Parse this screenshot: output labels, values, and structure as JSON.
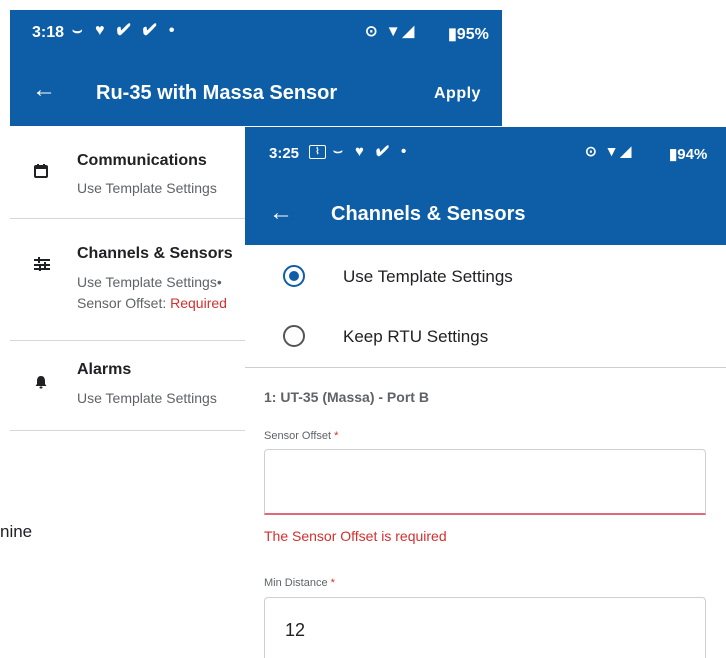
{
  "screen_a": {
    "status_bar": {
      "time": "3:18",
      "left_icons": "⌣ ♥ ✔ ✔ •",
      "right_icons": "⊙ ▼◢",
      "battery": "▮95%"
    },
    "app_bar": {
      "title": "Ru-35 with Massa Sensor",
      "action": "Apply"
    },
    "items": [
      {
        "icon": "calendar-icon",
        "title": "Communications",
        "subtitle": "Use Template Settings"
      },
      {
        "icon": "sliders-icon",
        "title": "Channels & Sensors",
        "subtitle": "Use Template Settings•",
        "subtitle2_prefix": "Sensor Offset: ",
        "subtitle2_required": "Required"
      },
      {
        "icon": "bell-icon",
        "title": "Alarms",
        "subtitle": "Use Template Settings"
      }
    ],
    "fragment_text": "nine"
  },
  "screen_b": {
    "status_bar": {
      "time": "3:25",
      "left_icons": "⌣ ♥ ✔ •",
      "right_icons": "⊙ ▼◢",
      "battery": "▮94%"
    },
    "app_bar": {
      "title": "Channels & Sensors"
    },
    "options": [
      {
        "label": "Use Template Settings",
        "selected": true
      },
      {
        "label": "Keep RTU Settings",
        "selected": false
      }
    ],
    "section_title": "1: UT-35 (Massa) - Port B",
    "fields": {
      "sensor_offset": {
        "label": "Sensor Offset",
        "required_marker": "*",
        "value": "",
        "error": "The Sensor Offset is required"
      },
      "min_distance": {
        "label": "Min Distance",
        "required_marker": "*",
        "value": "12"
      }
    }
  },
  "colors": {
    "primary": "#0d5ea6",
    "error": "#d32f2f",
    "divider": "#cfcfcf"
  }
}
